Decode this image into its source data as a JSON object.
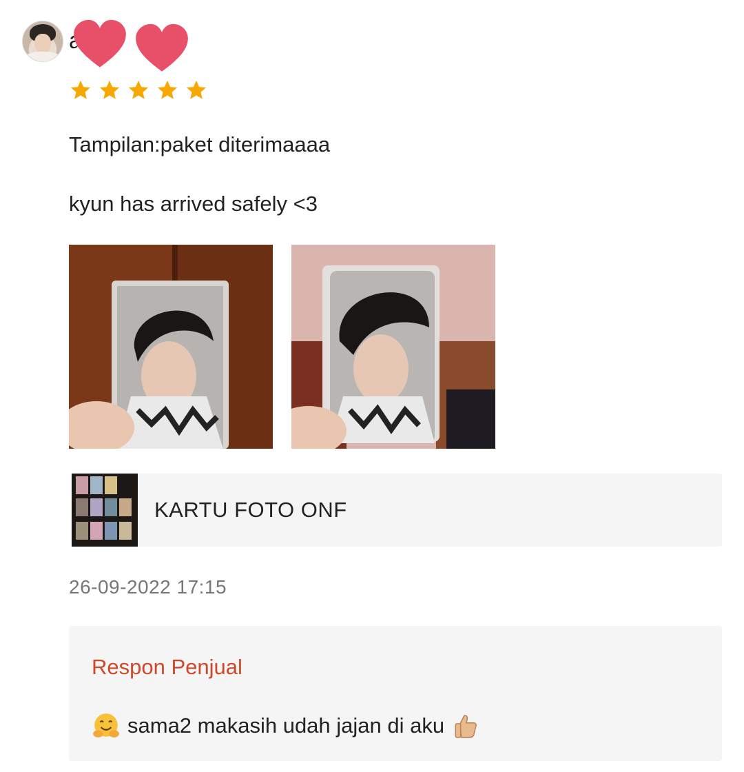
{
  "review": {
    "username": "a  r    a",
    "rating": 5,
    "variant_line": "Tampilan:paket diterimaaaa",
    "comment": "kyun has arrived safely <3",
    "photos": [
      "review-photo-1",
      "review-photo-2"
    ],
    "product_name": "KARTU FOTO ONF",
    "timestamp": "26-09-2022 17:15"
  },
  "seller_response": {
    "title": "Respon Penjual",
    "text": "sama2 makasih udah jajan di aku",
    "leading_emoji": "hugging-face-emoji",
    "trailing_emoji": "thumbs-up-emoji"
  },
  "colors": {
    "star": "#f6a700",
    "heart": "#e8506a",
    "response_title": "#d0482c",
    "timestamp": "#777777"
  },
  "icons": {
    "star": "star-icon",
    "heart": "heart-sticker-icon"
  }
}
